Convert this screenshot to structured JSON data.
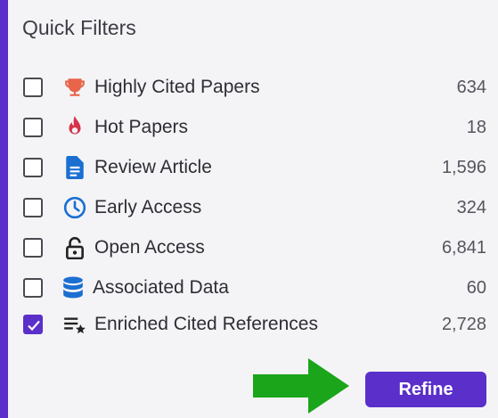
{
  "panel": {
    "title": "Quick Filters"
  },
  "filters": [
    {
      "label": "Highly Cited Papers",
      "count": "634",
      "checked": false,
      "icon": "trophy-icon",
      "icon_color": "#e8644a"
    },
    {
      "label": "Hot Papers",
      "count": "18",
      "checked": false,
      "icon": "flame-icon",
      "icon_color": "#d6324a"
    },
    {
      "label": "Review Article",
      "count": "1,596",
      "checked": false,
      "icon": "document-icon",
      "icon_color": "#1a6fd1"
    },
    {
      "label": "Early Access",
      "count": "324",
      "checked": false,
      "icon": "clock-icon",
      "icon_color": "#1a6fd1"
    },
    {
      "label": "Open Access",
      "count": "6,841",
      "checked": false,
      "icon": "unlock-icon",
      "icon_color": "#222222"
    },
    {
      "label": "Associated Data",
      "count": "60",
      "checked": false,
      "icon": "database-icon",
      "icon_color": "#1a6fd1"
    },
    {
      "label": "Enriched Cited References",
      "count": "2,728",
      "checked": true,
      "icon": "list-star-icon",
      "icon_color": "#222222"
    }
  ],
  "actions": {
    "refine_label": "Refine"
  },
  "colors": {
    "accent": "#5b2fc9",
    "arrow": "#1aa51a"
  }
}
